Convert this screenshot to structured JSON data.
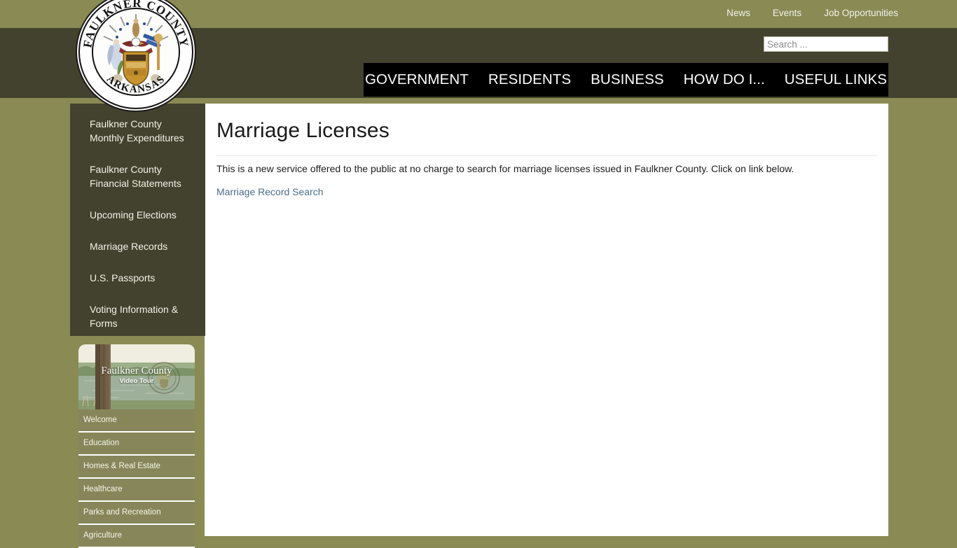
{
  "topbar": {
    "links": [
      {
        "label": "News"
      },
      {
        "label": "Events"
      },
      {
        "label": "Job Opportunities"
      }
    ]
  },
  "search": {
    "placeholder": "Search ...",
    "value": ""
  },
  "mainnav": {
    "items": [
      {
        "label": "GOVERNMENT"
      },
      {
        "label": "RESIDENTS"
      },
      {
        "label": "BUSINESS"
      },
      {
        "label": "HOW DO I..."
      },
      {
        "label": "USEFUL LINKS"
      }
    ]
  },
  "logo": {
    "top_arc_text": "FAULKNER COUNTY",
    "bottom_arc_text": "ARKANSAS",
    "alt": "Faulkner County Arkansas seal"
  },
  "sidebar": {
    "items": [
      {
        "label": "Faulkner County Monthly Expenditures"
      },
      {
        "label": "Faulkner County Financial Statements"
      },
      {
        "label": "Upcoming Elections"
      },
      {
        "label": "Marriage Records"
      },
      {
        "label": "U.S. Passports"
      },
      {
        "label": "Voting Information & Forms"
      }
    ]
  },
  "video_tour": {
    "banner_title": "Faulkner County",
    "banner_subtitle": "Video Tour",
    "items": [
      {
        "label": "Welcome"
      },
      {
        "label": "Education"
      },
      {
        "label": "Homes & Real Estate"
      },
      {
        "label": "Healthcare"
      },
      {
        "label": "Parks and Recreation"
      },
      {
        "label": "Agriculture"
      }
    ]
  },
  "main": {
    "title": "Marriage Licenses",
    "paragraph": "This is a new service offered to the public at no charge to search for marriage licenses issued in Faulkner County. Click on link below.",
    "link_label": "Marriage Record Search"
  },
  "colors": {
    "page_background": "#8a8a55",
    "header_band": "#43422e",
    "nav_background": "#000000",
    "content_background": "#ffffff",
    "link": "#4a6d8c",
    "video_item_background": "#87865a"
  }
}
